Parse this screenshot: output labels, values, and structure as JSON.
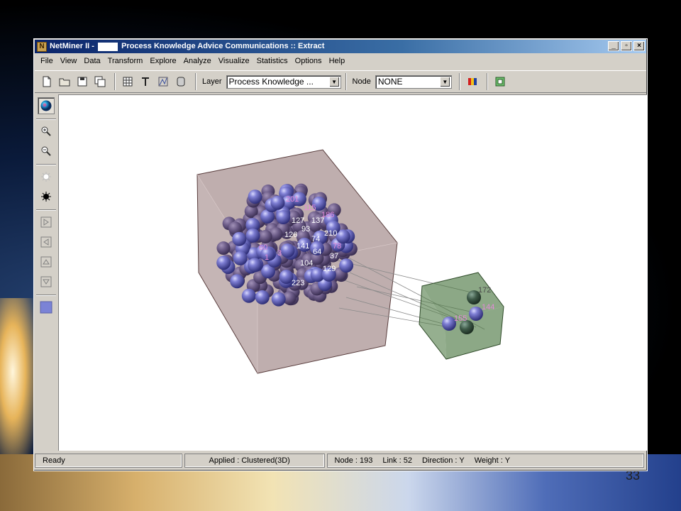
{
  "window": {
    "app_name": "NetMiner II -",
    "title_rest": "Process Knowledge Advice Communications :: Extract",
    "controls": [
      "_",
      "▫",
      "×"
    ]
  },
  "menu": [
    "File",
    "View",
    "Data",
    "Transform",
    "Explore",
    "Analyze",
    "Visualize",
    "Statistics",
    "Options",
    "Help"
  ],
  "toolbar": {
    "layer_label": "Layer",
    "layer_value": "Process Knowledge ...",
    "node_label": "Node",
    "node_value": "NONE"
  },
  "graph": {
    "big_cluster_labels": [
      "127",
      "137",
      "93",
      "126",
      "210",
      "74",
      "141",
      "64",
      "37",
      "104",
      "129",
      "223",
      "201",
      "115",
      "186",
      "3",
      "1",
      "60",
      "78"
    ],
    "small_cluster_labels": [
      "172",
      "144",
      "155"
    ],
    "colors": {
      "big_box": "#8b5a5a",
      "small_box": "#4f7a45",
      "node": "#6f6fc8",
      "node_dark": "#3e5a48",
      "label": "#e38ad8"
    }
  },
  "status": {
    "ready": "Ready",
    "applied": "Applied : Clustered(3D)",
    "node": "Node : 193",
    "link": "Link : 52",
    "direction": "Direction : Y",
    "weight": "Weight : Y"
  },
  "slide_number": "33"
}
